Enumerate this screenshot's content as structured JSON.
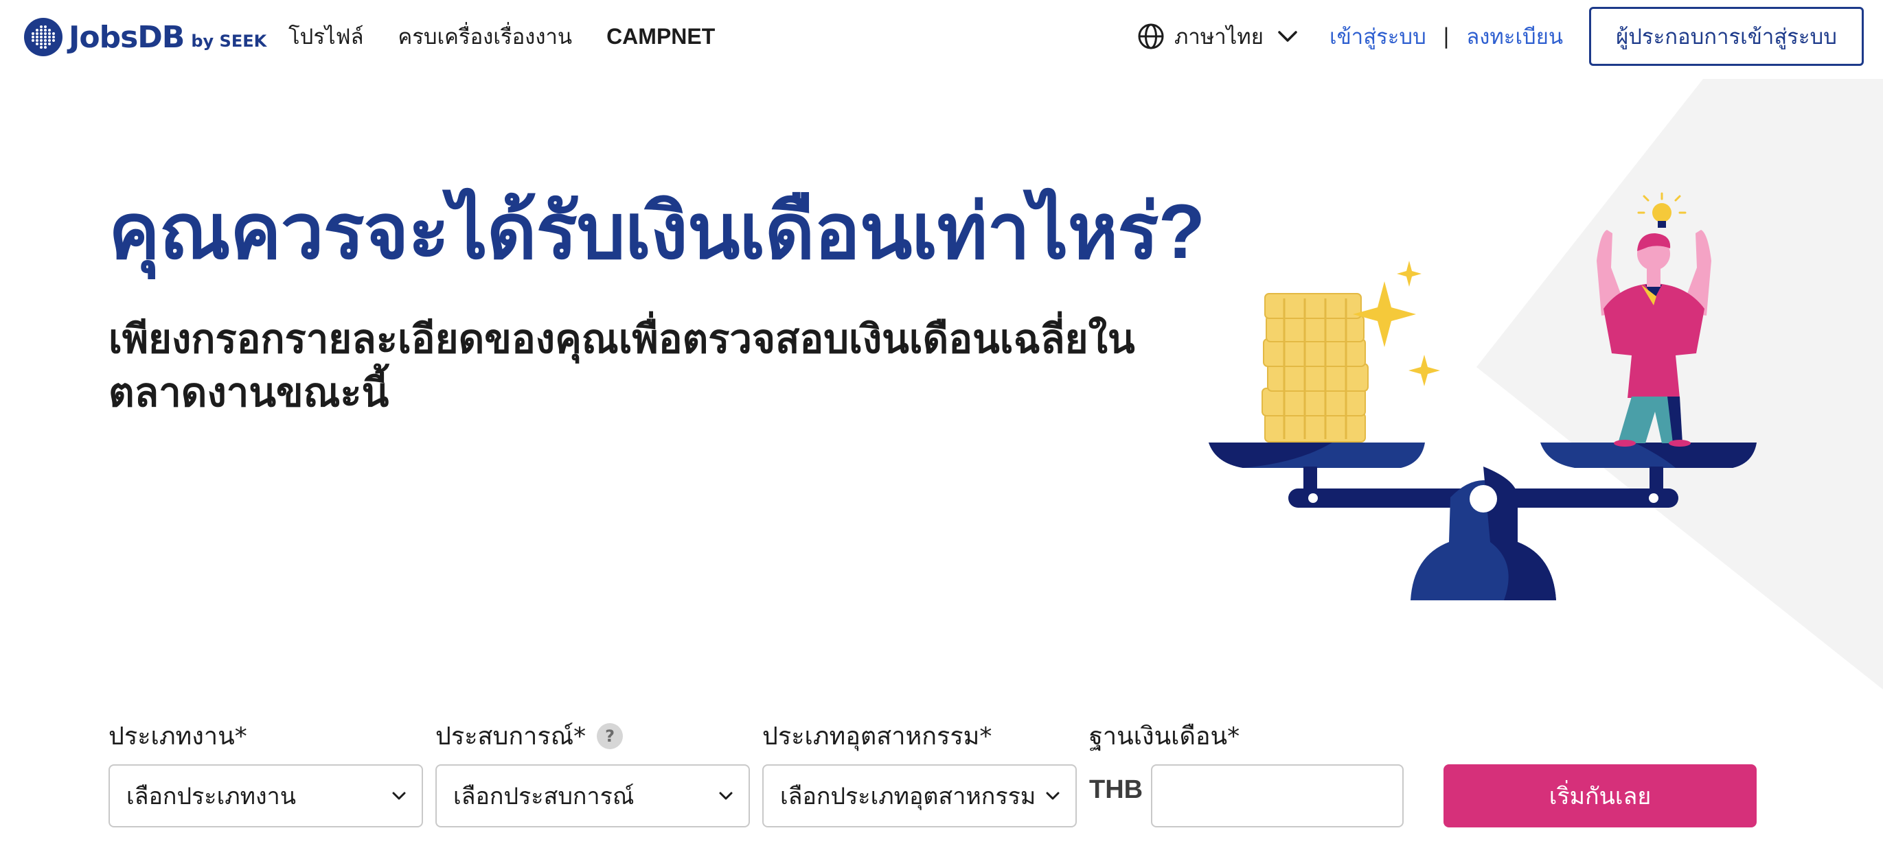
{
  "header": {
    "logo_text": "JobsDB",
    "logo_by": "by SEEK",
    "nav": [
      {
        "label": "โปรไฟล์"
      },
      {
        "label": "ครบเครื่องเรื่องงาน"
      },
      {
        "label": "CAMPNET"
      }
    ],
    "language": "ภาษาไทย",
    "login": "เข้าสู่ระบบ",
    "separator": "|",
    "register": "ลงทะเบียน",
    "employer_login": "ผู้ประกอบการเข้าสู่ระบบ"
  },
  "hero": {
    "title": "คุณควรจะได้รับเงินเดือนเท่าไหร่?",
    "subtitle": "เพียงกรอกรายละเอียดของคุณเพื่อตรวจสอบเงินเดือนเฉลี่ยในตลาดงานขณะนี้"
  },
  "form": {
    "job_type": {
      "label": "ประเภทงาน*",
      "value": "เลือกประเภทงาน"
    },
    "experience": {
      "label": "ประสบการณ์*",
      "value": "เลือกประสบการณ์",
      "help": "?"
    },
    "industry": {
      "label": "ประเภทอุตสาหกรรม*",
      "value": "เลือกประเภทอุตสาหกรรม"
    },
    "salary": {
      "label": "ฐานเงินเดือน*",
      "currency": "THB",
      "value": "",
      "placeholder": ""
    },
    "submit": "เริ่มกันเลย"
  },
  "colors": {
    "brand_navy": "#1d3a8a",
    "link_blue": "#2e5fd0",
    "cta_pink": "#d6307a",
    "coin_yellow": "#f5d36b",
    "scale_navy": "#12206b"
  },
  "icons": [
    "jobsdb-logo-icon",
    "globe-icon",
    "chevron-down-icon",
    "help-icon",
    "scale-illustration"
  ]
}
